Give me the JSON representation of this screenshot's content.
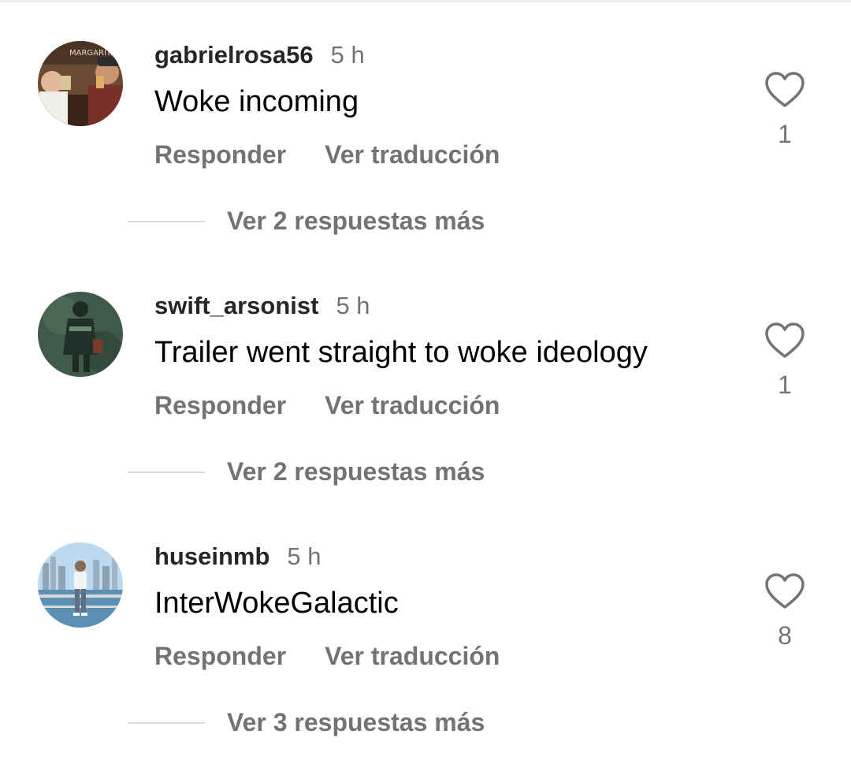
{
  "comments": [
    {
      "username": "gabrielrosa56",
      "timestamp": "5 h",
      "text": "Woke incoming",
      "reply_label": "Responder",
      "translate_label": "Ver traducción",
      "view_replies_label": "Ver 2 respuestas más",
      "like_count": "1",
      "avatar_sign_text": "MARGARITAS"
    },
    {
      "username": "swift_arsonist",
      "timestamp": "5 h",
      "text": "Trailer went straight to woke ideology",
      "reply_label": "Responder",
      "translate_label": "Ver traducción",
      "view_replies_label": "Ver 2 respuestas más",
      "like_count": "1"
    },
    {
      "username": "huseinmb",
      "timestamp": "5 h",
      "text": "InterWokeGalactic",
      "reply_label": "Responder",
      "translate_label": "Ver traducción",
      "view_replies_label": "Ver 3 respuestas más",
      "like_count": "8"
    }
  ],
  "colors": {
    "username": "#262626",
    "secondary_text": "#737373",
    "comment_text": "#000000",
    "reply_line": "#dbdbdb",
    "heart_outline": "#737373"
  },
  "icons": {
    "like": "heart-outline-icon"
  }
}
